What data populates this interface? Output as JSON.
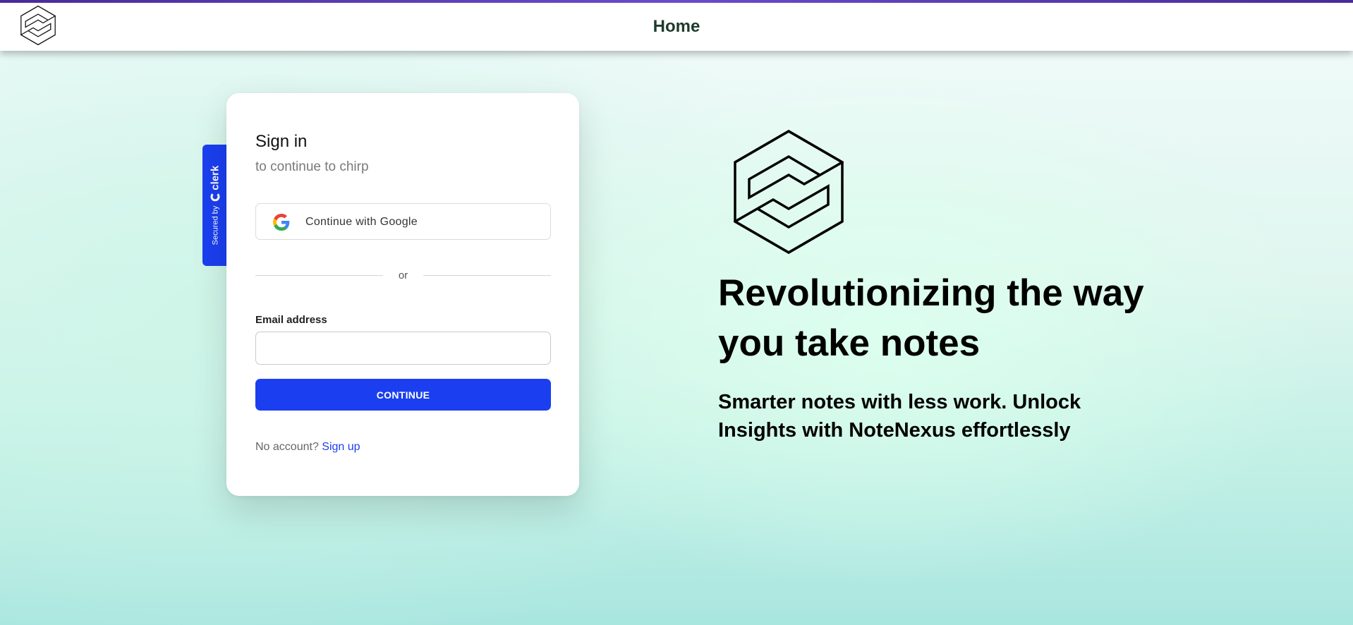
{
  "navbar": {
    "title": "Home",
    "logo_icon": "notenexus-logo-icon"
  },
  "clerk_badge": {
    "secured_by": "Secured by",
    "brand": "clerk"
  },
  "signin": {
    "title": "Sign in",
    "subtitle": "to continue to chirp",
    "google_button_label": "Continue with Google",
    "divider_text": "or",
    "email_label": "Email address",
    "email_value": "",
    "continue_label": "CONTINUE",
    "no_account_text": "No account?",
    "signup_link": "Sign up"
  },
  "hero": {
    "logo_icon": "notenexus-logo-icon",
    "heading": "Revolutionizing the way you take notes",
    "subheading": "Smarter notes with less work. Unlock Insights with NoteNexus effortlessly"
  },
  "colors": {
    "accent": "#1b3ff0",
    "nav_title": "#1e3b2d",
    "top_bar": "#4a2a9a"
  }
}
